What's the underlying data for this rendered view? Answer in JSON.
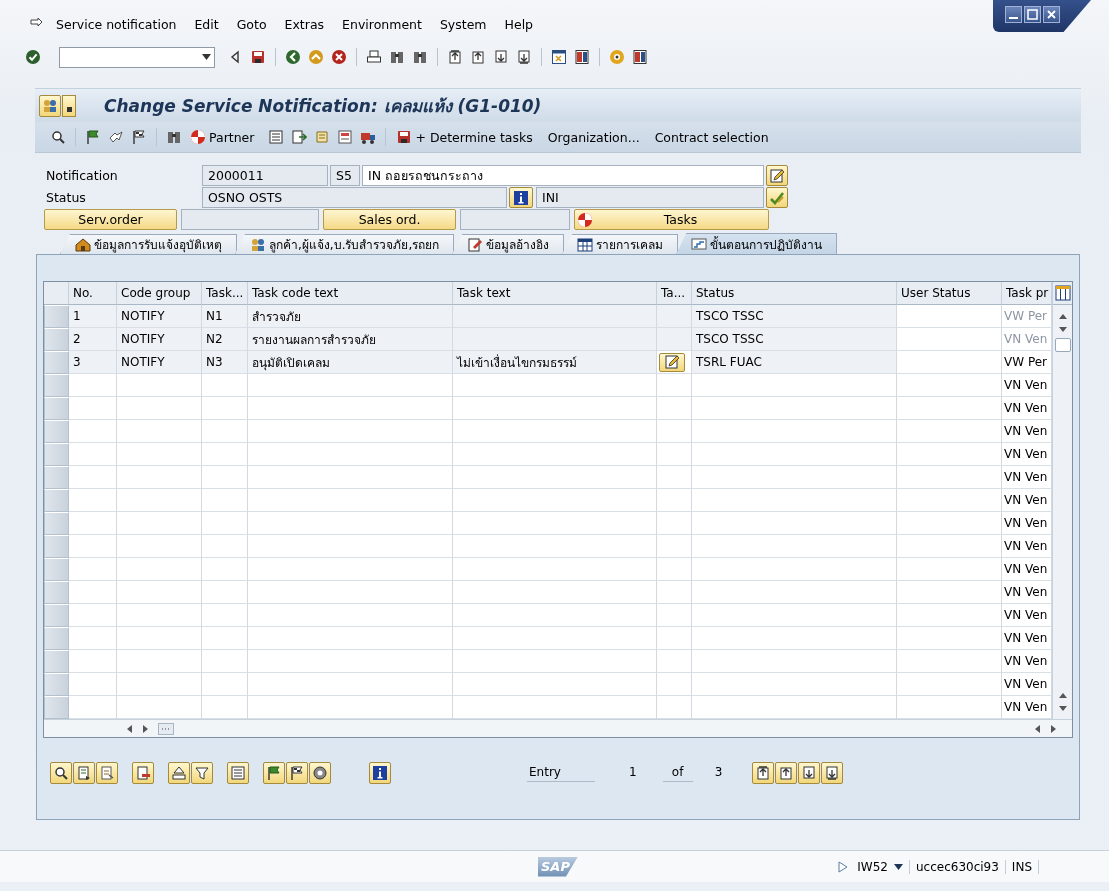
{
  "menu": [
    {
      "label": "Service notification"
    },
    {
      "label": "Edit"
    },
    {
      "label": "Goto"
    },
    {
      "label": "Extras"
    },
    {
      "label": "Environment"
    },
    {
      "label": "System"
    },
    {
      "label": "Help"
    }
  ],
  "window": {
    "title": "Change Service Notification: เคลมแห้ง (G1-010)"
  },
  "app_toolbar": {
    "partner": "Partner",
    "determine": "+ Determine tasks",
    "organization": "Organization...",
    "contract": "Contract selection"
  },
  "header": {
    "notification_label": "Notification",
    "notification": "2000011",
    "priority": "S5",
    "description": "IN ถอยรถชนกระถาง",
    "status_label": "Status",
    "status": "OSNO OSTS",
    "user_status": "INI",
    "serv_order": "Serv.order",
    "sales_order": "Sales ord.",
    "tasks": "Tasks"
  },
  "tabs": [
    {
      "label": "ข้อมูลการรับแจ้งอุบัติเหตุ",
      "selected": false
    },
    {
      "label": "ลูกค้า,ผู้แจ้ง,บ.รับสำรวจภัย,รถยก",
      "selected": false
    },
    {
      "label": "ข้อมูลอ้างอิง",
      "selected": false
    },
    {
      "label": "รายการเคลม",
      "selected": false
    },
    {
      "label": "ขั้นตอนการปฏิบัติงาน",
      "selected": true
    }
  ],
  "table": {
    "columns": [
      "No.",
      "Code group",
      "Task...",
      "Task code text",
      "Task text",
      "Ta...",
      "Status",
      "User Status",
      "Task pr"
    ],
    "rows": [
      {
        "no": "1",
        "code_group": "NOTIFY",
        "task": "N1",
        "task_code_text": "สำรวจภัย",
        "note": false,
        "status": "TSCO TSSC",
        "task_pr": "VW Per",
        "disabled": true
      },
      {
        "no": "2",
        "code_group": "NOTIFY",
        "task": "N2",
        "task_code_text": "รายงานผลการสำรวจภัย",
        "note": false,
        "status": "TSCO TSSC",
        "task_pr": "VN Ven",
        "disabled": true
      },
      {
        "no": "3",
        "code_group": "NOTIFY",
        "task": "N3",
        "task_code_text": "อนุมัติเปิดเคลม",
        "task_text": "ไม่เข้าเงื่อนไขกรมธรรม์",
        "note": true,
        "status": "TSRL FUAC",
        "task_pr": "VW Per",
        "disabled": false
      },
      {
        "task_pr": "VN Ven",
        "note": false,
        "disabled": false
      },
      {
        "task_pr": "VN Ven",
        "note": false,
        "disabled": false
      },
      {
        "task_pr": "VN Ven",
        "note": false,
        "disabled": false
      },
      {
        "task_pr": "VN Ven",
        "note": false,
        "disabled": false
      },
      {
        "task_pr": "VN Ven",
        "note": false,
        "disabled": false
      },
      {
        "task_pr": "VN Ven",
        "note": false,
        "disabled": false
      },
      {
        "task_pr": "VN Ven",
        "note": false,
        "disabled": false
      },
      {
        "task_pr": "VN Ven",
        "note": false,
        "disabled": false
      },
      {
        "task_pr": "VN Ven",
        "note": false,
        "disabled": false
      },
      {
        "task_pr": "VN Ven",
        "note": false,
        "disabled": false
      },
      {
        "task_pr": "VN Ven",
        "note": false,
        "disabled": false
      },
      {
        "task_pr": "VN Ven",
        "note": false,
        "disabled": false
      },
      {
        "task_pr": "VN Ven",
        "note": false,
        "disabled": false
      },
      {
        "task_pr": "VN Ven",
        "note": false,
        "disabled": false
      },
      {
        "task_pr": "VN Ven",
        "note": false,
        "disabled": false
      }
    ]
  },
  "pager": {
    "label": "Entry",
    "current": "1",
    "of": "of",
    "total": "3"
  },
  "status_bar": {
    "logo": "SAP",
    "transaction": "IW52",
    "server": "uccec630ci93",
    "mode": "INS"
  }
}
